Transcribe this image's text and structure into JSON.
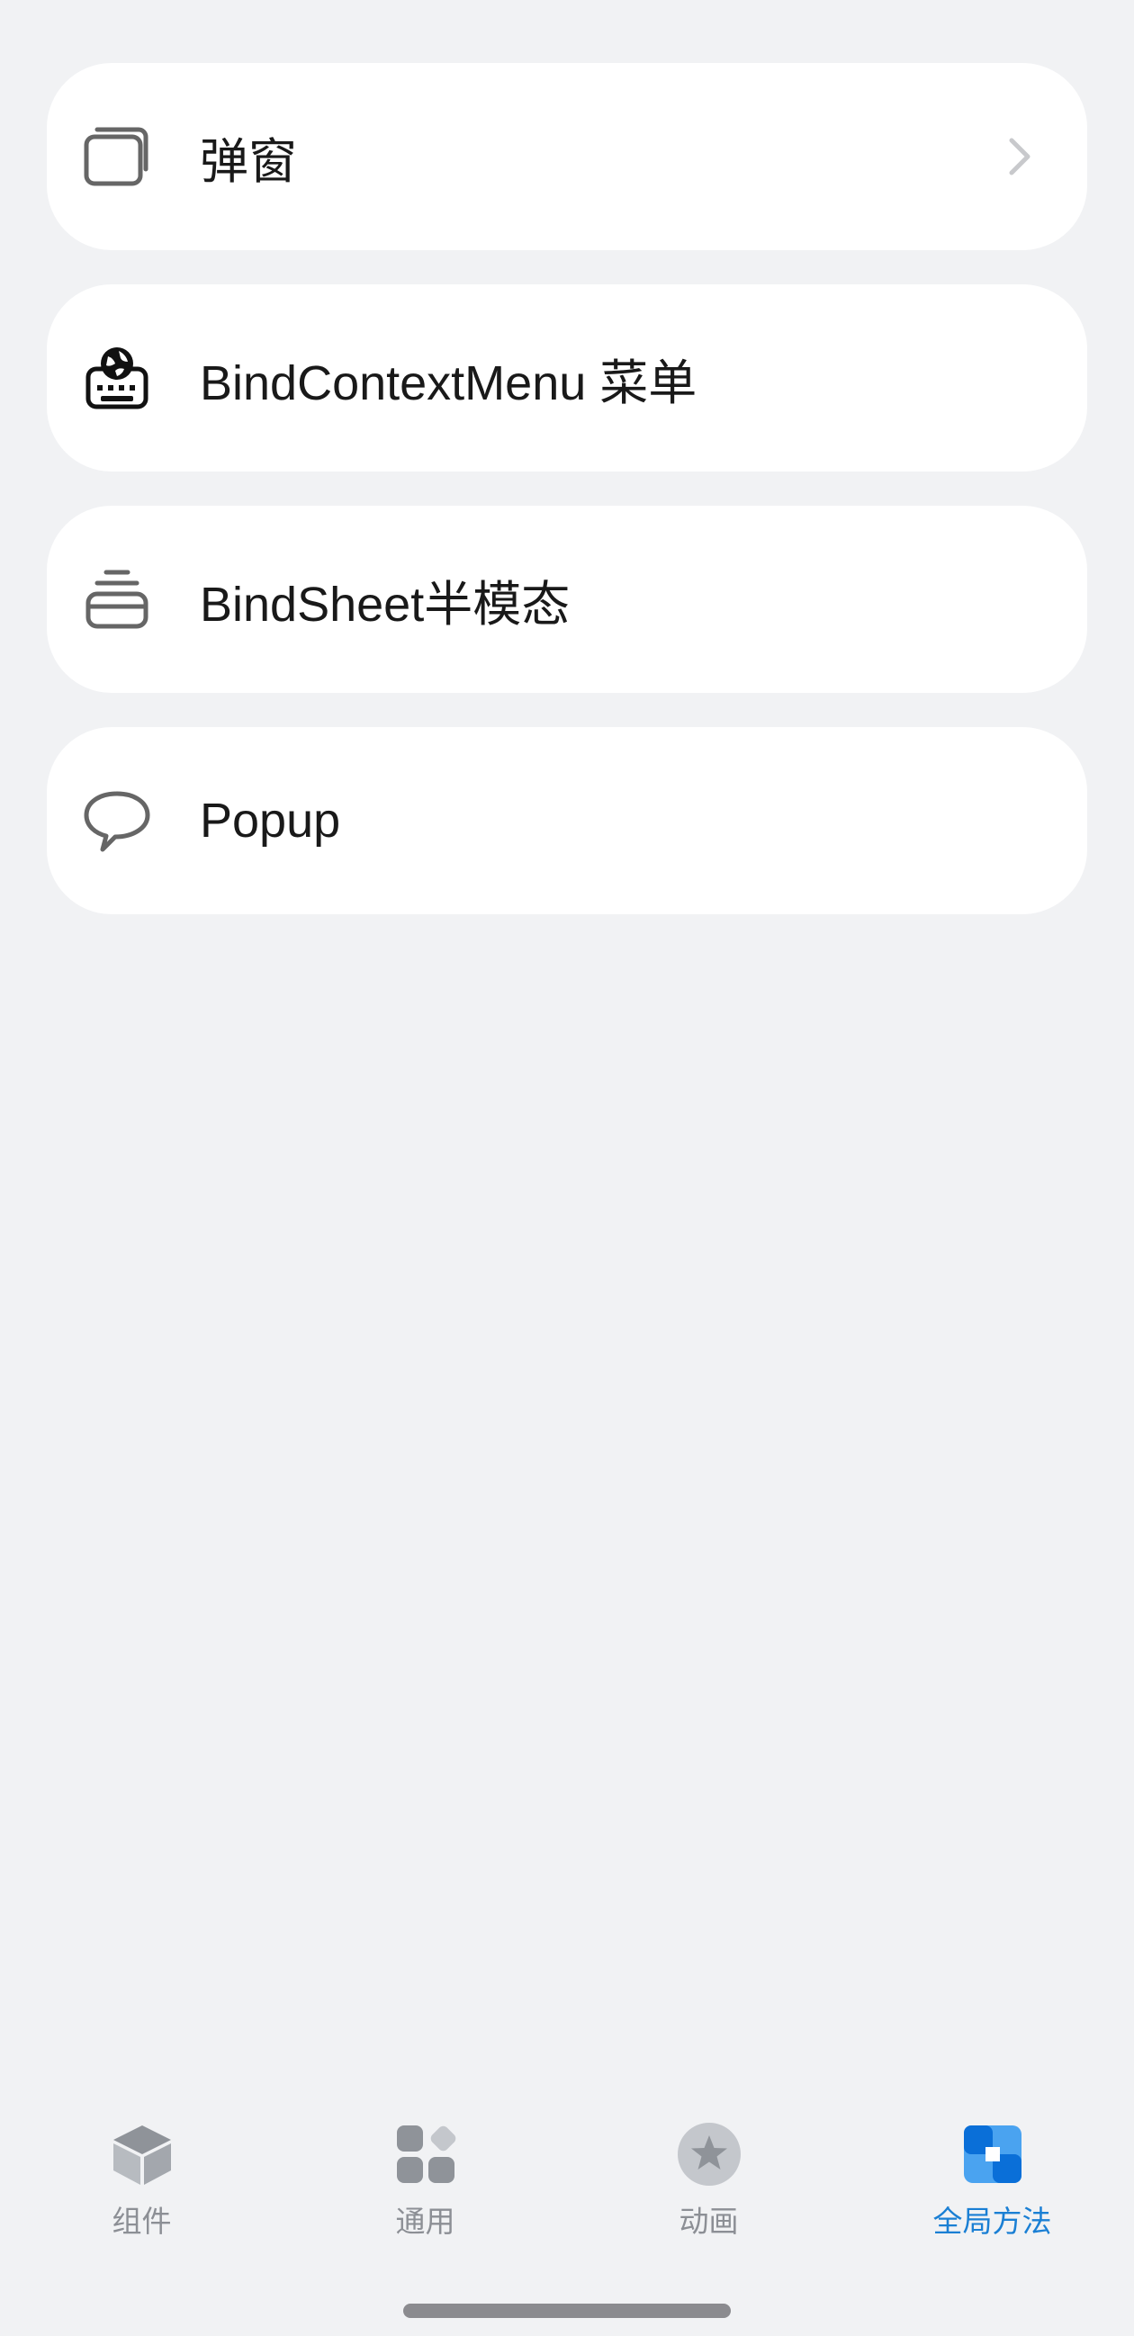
{
  "list": {
    "items": [
      {
        "label": "弹窗",
        "icon": "stacked-windows-icon",
        "has_chevron": true
      },
      {
        "label": "BindContextMenu 菜单",
        "icon": "globe-keyboard-icon",
        "has_chevron": false
      },
      {
        "label": "BindSheet半模态",
        "icon": "stacked-sheet-icon",
        "has_chevron": false
      },
      {
        "label": "Popup",
        "icon": "speech-bubble-icon",
        "has_chevron": false
      }
    ]
  },
  "tabbar": {
    "tabs": [
      {
        "label": "组件",
        "icon": "cube-icon",
        "active": false
      },
      {
        "label": "通用",
        "icon": "grid-icon",
        "active": false
      },
      {
        "label": "动画",
        "icon": "star-circle-icon",
        "active": false
      },
      {
        "label": "全局方法",
        "icon": "global-method-icon",
        "active": true
      }
    ]
  },
  "colors": {
    "background": "#f1f2f4",
    "card": "#ffffff",
    "text": "#191919",
    "tab_inactive": "#8c8f95",
    "tab_active": "#1a7fd4",
    "icon_gray": "#a0a3a8"
  }
}
